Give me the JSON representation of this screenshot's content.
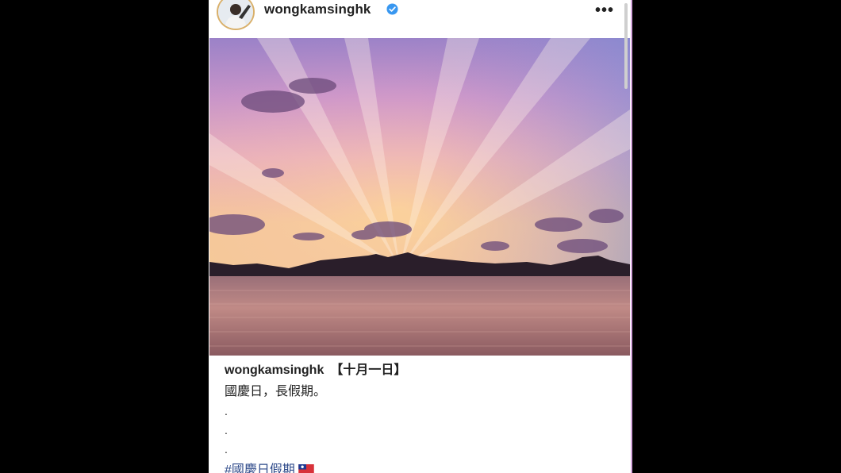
{
  "post": {
    "username": "wongkamsinghk",
    "verified_icon": "verified-badge-icon",
    "more_icon": "more-options-icon",
    "more_label": "•••",
    "photo_alt": "sunset over harbour"
  },
  "caption": {
    "username": "wongkamsinghk",
    "date_tag": "【十月一日】",
    "line2": "國慶日，長假期。",
    "dots": [
      ".",
      ".",
      "."
    ],
    "hashtag": "#國慶日假期"
  },
  "colors": {
    "accent_link": "#2e4a8a",
    "verified": "#3897f0",
    "avatar_ring": "#d9b06a"
  }
}
